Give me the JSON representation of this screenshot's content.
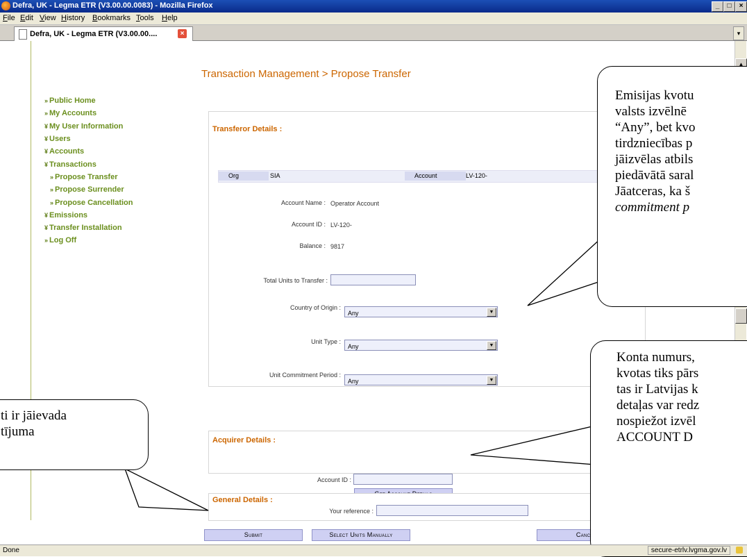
{
  "window": {
    "title": "Defra, UK - Legma ETR (V3.00.00.0083) - Mozilla Firefox",
    "controls": [
      "_",
      "□",
      "×"
    ]
  },
  "menu": [
    "File",
    "Edit",
    "View",
    "History",
    "Bookmarks",
    "Tools",
    "Help"
  ],
  "tab": {
    "label": "Defra, UK - Legma ETR (V3.00.00....",
    "close": "×"
  },
  "nav": {
    "items": [
      {
        "arrow": "»",
        "label": "Public Home"
      },
      {
        "arrow": "»",
        "label": "My Accounts"
      },
      {
        "arrow": "¥",
        "label": "My User Information"
      },
      {
        "arrow": "¥",
        "label": "Users"
      },
      {
        "arrow": "¥",
        "label": "Accounts"
      },
      {
        "arrow": "¥",
        "label": "Transactions"
      },
      {
        "arrow": "»",
        "label": "Propose Transfer"
      },
      {
        "arrow": "»",
        "label": "Propose Surrender"
      },
      {
        "arrow": "»",
        "label": "Propose Cancellation"
      },
      {
        "arrow": "¥",
        "label": "Emissions"
      },
      {
        "arrow": "¥",
        "label": "Transfer Installation"
      },
      {
        "arrow": "»",
        "label": "Log Off"
      }
    ]
  },
  "page": {
    "title": "Transaction Management > Propose Transfer"
  },
  "transferor": {
    "heading": "Transferor Details :",
    "org_label": "Org",
    "org_value": "SIA",
    "account_label": "Account",
    "account_value": "LV-120-",
    "account_name_label": "Account Name :",
    "account_name": "Operator Account",
    "account_id_label": "Account ID :",
    "account_id": "LV-120-",
    "balance_label": "Balance :",
    "balance": "9817",
    "total_units_label": "Total Units to Transfer :",
    "total_units_value": "",
    "country_label": "Country of Origin :",
    "country_value": "Any",
    "unit_type_label": "Unit Type :",
    "unit_type_value": "Any",
    "commitment_label": "Unit Commitment Period :",
    "commitment_value": "Any"
  },
  "acquirer": {
    "heading": "Acquirer Details :",
    "account_id_label": "Account ID :",
    "account_id_value": "",
    "get_button": "Get Account Details"
  },
  "general": {
    "heading": "General Details :",
    "reference_label": "Your reference :",
    "reference_value": ""
  },
  "buttons": {
    "submit": "Submit",
    "select_manually": "Select Units Manually",
    "cancel": "Cancel"
  },
  "status": {
    "text": "Done",
    "url": "secure-etrlv.lvgma.gov.lv"
  },
  "callouts": {
    "top_right": [
      "Emisijas kvotu",
      "valsts izvēlnē",
      "“Any”, bet kvo",
      "tirdzniecības p",
      "jāizvēlas atbils",
      "piedāvātā saral",
      "Jāatceras, ka š",
      "commitment p"
    ],
    "mid_right": [
      "Konta numurs,",
      "kvotas tiks pārs",
      "tas ir Latvijas k",
      "detaļas var redz",
      "nospiežot izvēl",
      "ACCOUNT D"
    ],
    "left": [
      "ti ir jāievada",
      "tījuma"
    ]
  }
}
